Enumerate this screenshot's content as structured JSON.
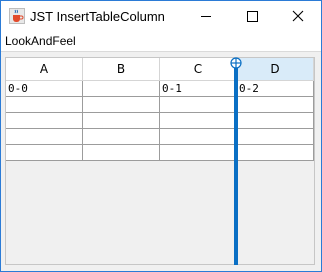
{
  "window": {
    "title": "JST InsertTableColumn"
  },
  "menu": {
    "items": [
      "LookAndFeel"
    ]
  },
  "table": {
    "columns": [
      "A",
      "B",
      "C",
      "D"
    ],
    "selected_column": "D",
    "rows": [
      [
        "0-0",
        "",
        "0-1",
        "0-2"
      ],
      [
        "",
        "",
        "",
        ""
      ],
      [
        "",
        "",
        "",
        ""
      ],
      [
        "",
        "",
        "",
        ""
      ],
      [
        "",
        "",
        "",
        ""
      ]
    ]
  },
  "colors": {
    "accent": "#0a6fc4",
    "selected_header": "#d9ebf9",
    "grid": "#9c9c9c"
  },
  "icons": {
    "app": "java-cup-icon",
    "drop": "crosshair-circle-icon"
  }
}
